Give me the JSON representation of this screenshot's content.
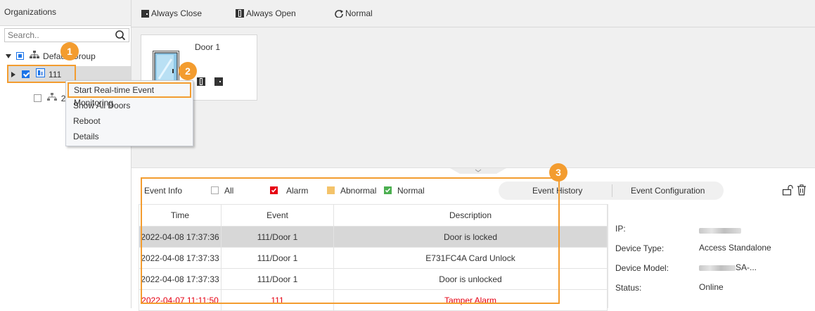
{
  "sidebar": {
    "title": "Organizations",
    "search_placeholder": "Search..",
    "tree": {
      "group_label": "Default Group",
      "device_label": "111",
      "sub_label": "2"
    }
  },
  "context_menu": {
    "items": [
      "Start Real-time Event Monitoring",
      "Show All Doors",
      "Reboot",
      "Details"
    ]
  },
  "toolbar": {
    "always_close": "Always Close",
    "always_open": "Always Open",
    "normal": "Normal"
  },
  "door": {
    "name": "Door 1"
  },
  "event_bar": {
    "title": "Event Info",
    "filters": {
      "all": "All",
      "alarm": "Alarm",
      "abnormal": "Abnormal",
      "normal": "Normal"
    },
    "tabs": {
      "history": "Event History",
      "configuration": "Event Configuration"
    }
  },
  "table": {
    "columns": [
      "Time",
      "Event",
      "Description"
    ],
    "rows": [
      {
        "time": "2022-04-08 17:37:36",
        "event": "111/Door 1",
        "description": "Door is locked"
      },
      {
        "time": "2022-04-08 17:37:33",
        "event": "111/Door 1",
        "description": "E731FC4A Card Unlock"
      },
      {
        "time": "2022-04-08 17:37:33",
        "event": "111/Door 1",
        "description": "Door is unlocked"
      },
      {
        "time": "2022-04-07 11:11:50",
        "event": "111",
        "description": "Tamper Alarm"
      }
    ]
  },
  "device_info": {
    "ip_label": "IP:",
    "type_label": "Device Type:",
    "type_value": "Access Standalone",
    "model_label": "Device Model:",
    "model_value_suffix": "SA-...",
    "status_label": "Status:",
    "status_value": "Online"
  },
  "callouts": [
    "1",
    "2",
    "3"
  ],
  "colors": {
    "accent": "#f39c2f",
    "alarm": "#e60012",
    "checkbox_blue": "#1a73e8",
    "abnormal": "#f4c36a",
    "normal_green": "#4caf50"
  }
}
